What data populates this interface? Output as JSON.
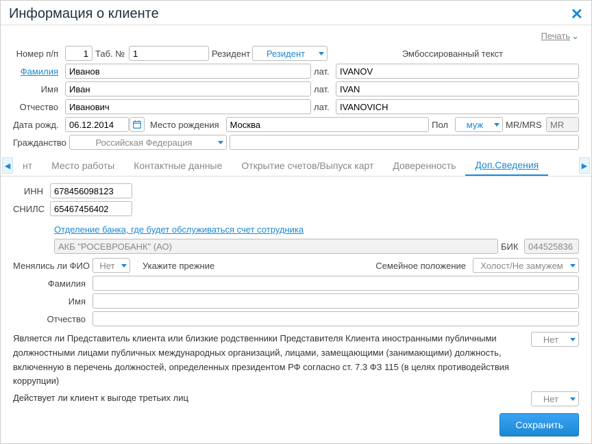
{
  "dialog": {
    "title": "Информация о клиенте",
    "print": "Печать",
    "save": "Сохранить"
  },
  "top": {
    "numPp_label": "Номер п/п",
    "numPp": "1",
    "tabNo_label": "Таб. №",
    "tabNo": "1",
    "resident_label": "Резидент",
    "resident_val": "Резидент",
    "emboss_label": "Эмбоссированный текст",
    "surname_label": "Фамилия",
    "surname": "Иванов",
    "lat_label": "лат.",
    "surname_lat": "IVANOV",
    "name_label": "Имя",
    "name": "Иван",
    "name_lat": "IVAN",
    "patronymic_label": "Отчество",
    "patronymic": "Иванович",
    "patronymic_lat": "IVANOVICH",
    "dob_label": "Дата рожд.",
    "dob": "06.12.2014",
    "pob_label": "Место рождения",
    "pob": "Москва",
    "sex_label": "Пол",
    "sex_val": "муж",
    "mrmrs_label": "MR/MRS",
    "mrmrs_ph": "MR",
    "citizenship_label": "Гражданство",
    "citizenship_val": "Российская Федерация"
  },
  "tabs": {
    "t0": "нт",
    "t1": "Место работы",
    "t2": "Контактные данные",
    "t3": "Открытие счетов/Выпуск карт",
    "t4": "Доверенность",
    "t5": "Доп.Сведения"
  },
  "extra": {
    "inn_label": "ИНН",
    "inn": "678456098123",
    "snils_label": "СНИЛС",
    "snils": "65467456402",
    "bank_link": "Отделение банка, где будет обслуживаться счет сотрудника",
    "bank": "АКБ \"РОСЕВРОБАНК\" (АО)",
    "bik_label": "БИК",
    "bik": "044525836",
    "fio_change_label": "Менялись ли ФИО",
    "fio_change_val": "Нет",
    "prev_label": "Укажите прежние",
    "marital_label": "Семейное положение",
    "marital_val": "Холост/Не замужем",
    "prev_surname_label": "Фамилия",
    "prev_name_label": "Имя",
    "prev_patr_label": "Отчество",
    "q1": "Является ли Представитель клиента или близкие родственники Представителя Клиента иностранными публичными должностными лицами публичных международных организаций, лицами, замещающими (занимающими) должность, включенную в перечень должностей, определенных президентом РФ согласно ст. 7.3 ФЗ 115 (в целях противодействия коррупции)",
    "q1_val": "Нет",
    "q2": "Действует ли клиент к выгоде третьих лиц",
    "q2_val": "Нет"
  }
}
